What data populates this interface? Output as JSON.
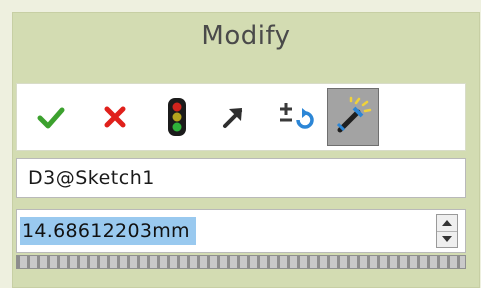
{
  "dialog": {
    "title": "Modify",
    "toolbar": {
      "buttons": [
        {
          "name": "ok",
          "icon": "checkmark-icon",
          "color": "#3ca12e"
        },
        {
          "name": "cancel",
          "icon": "close-icon",
          "color": "#e0201b"
        },
        {
          "name": "rebuild",
          "icon": "traffic-light-icon"
        },
        {
          "name": "mark-for-drawing",
          "icon": "arrow-up-right-icon"
        },
        {
          "name": "reverse-dimension",
          "icon": "plus-minus-reverse-icon"
        },
        {
          "name": "mark-dimension",
          "icon": "dimension-wand-icon",
          "pressed": true
        }
      ]
    },
    "dimension_name": "D3@Sketch1",
    "value": "14.68612203mm",
    "value_selected": true
  },
  "colors": {
    "frame_bg": "#d3dcb2",
    "selection": "#99c9ef"
  }
}
